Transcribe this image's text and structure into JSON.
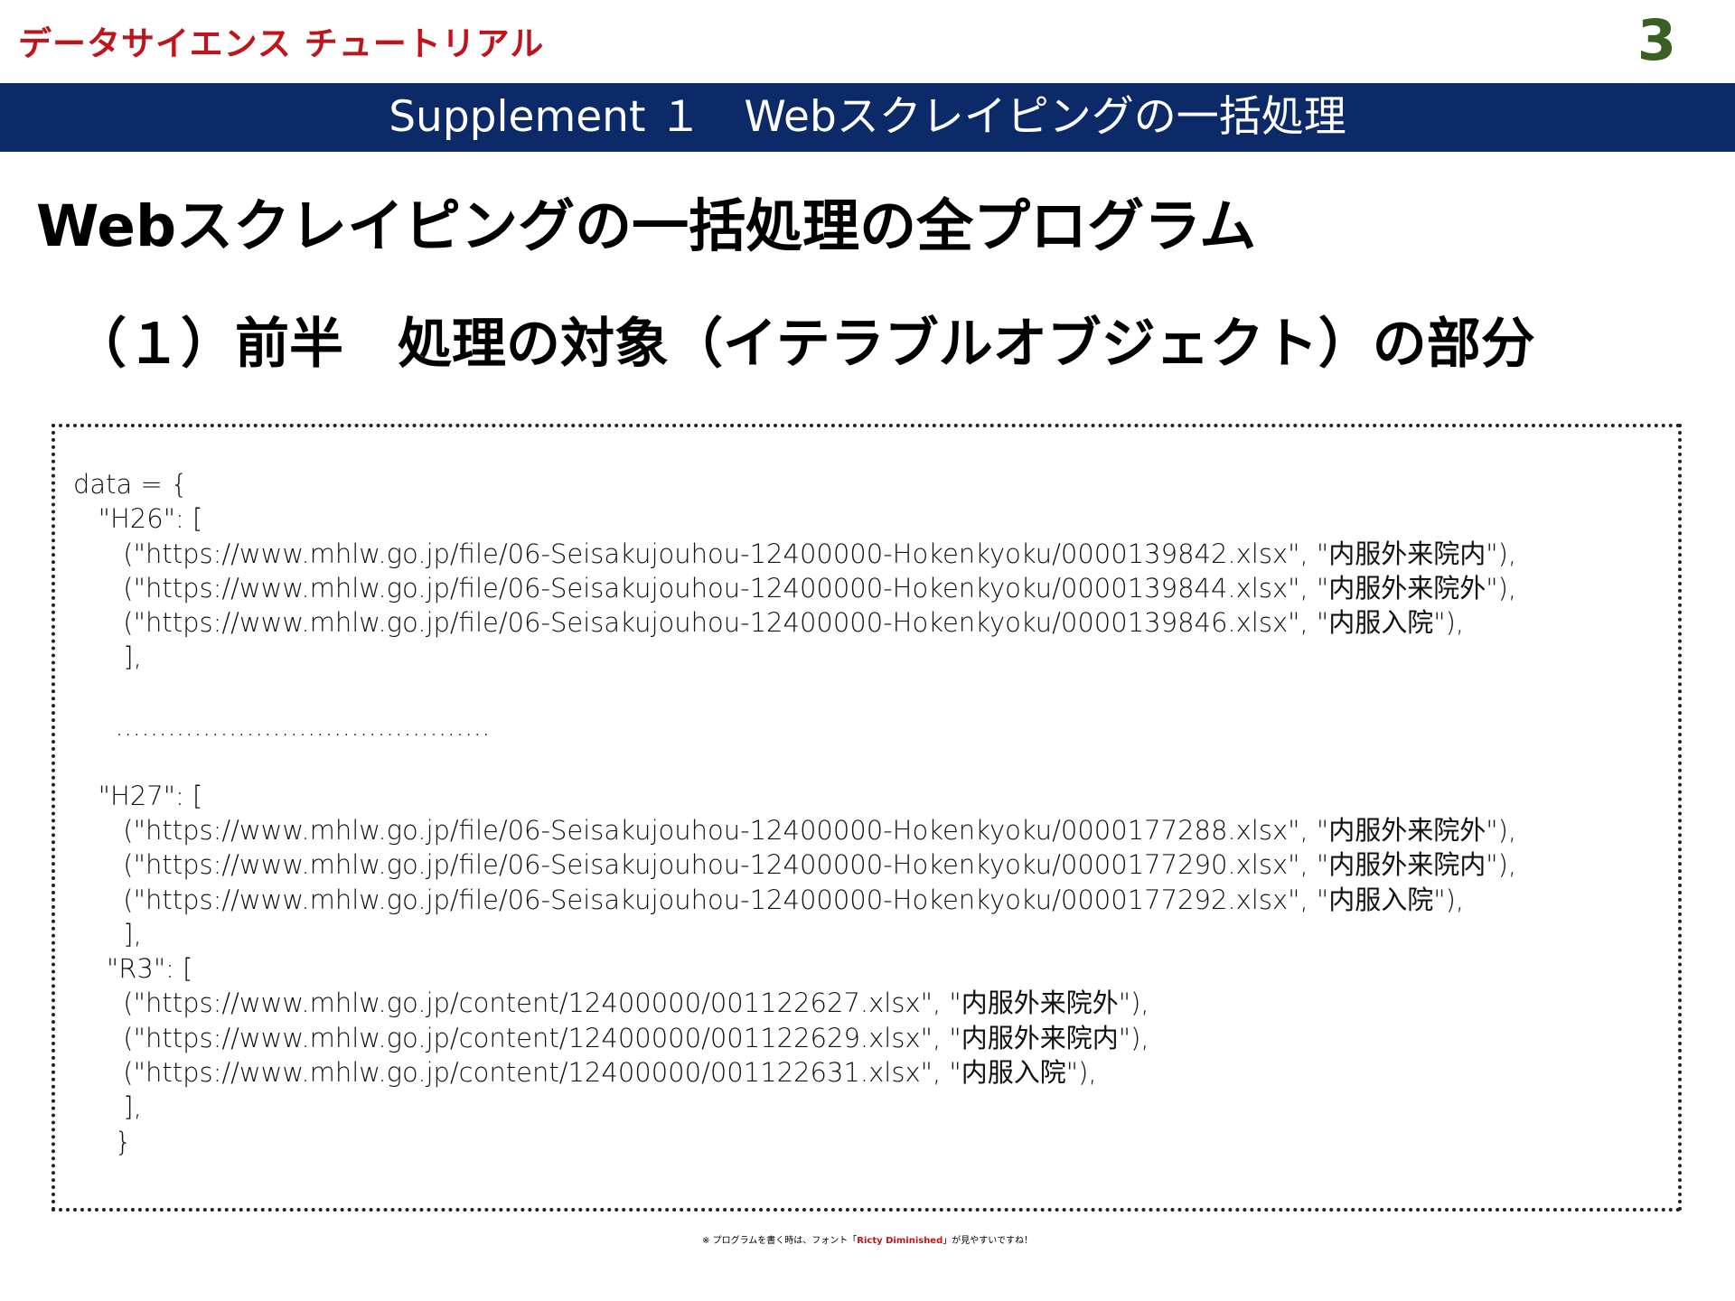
{
  "header": {
    "brand": "データサイエンス チュートリアル",
    "page_number": "3"
  },
  "banner": {
    "title": "Supplement １　Webスクレイピングの一括処理"
  },
  "main": {
    "heading": "Webスクレイピングの一括処理の全プログラム",
    "subheading": "（１）前半　処理の対象（イテラブルオブジェクト）の部分",
    "code_lines": [
      "data = {",
      "   \"H26\": [",
      "      (\"https://www.mhlw.go.jp/file/06-Seisakujouhou-12400000-Hokenkyoku/0000139842.xlsx\", \"内服外来院内\"),",
      "      (\"https://www.mhlw.go.jp/file/06-Seisakujouhou-12400000-Hokenkyoku/0000139844.xlsx\", \"内服外来院外\"),",
      "      (\"https://www.mhlw.go.jp/file/06-Seisakujouhou-12400000-Hokenkyoku/0000139846.xlsx\", \"内服入院\"),",
      "      ],",
      "",
      "     …………………………………….",
      "",
      "   \"H27\": [",
      "      (\"https://www.mhlw.go.jp/file/06-Seisakujouhou-12400000-Hokenkyoku/0000177288.xlsx\", \"内服外来院外\"),",
      "      (\"https://www.mhlw.go.jp/file/06-Seisakujouhou-12400000-Hokenkyoku/0000177290.xlsx\", \"内服外来院内\"),",
      "      (\"https://www.mhlw.go.jp/file/06-Seisakujouhou-12400000-Hokenkyoku/0000177292.xlsx\", \"内服入院\"),",
      "      ],",
      "    \"R3\": [",
      "      (\"https://www.mhlw.go.jp/content/12400000/001122627.xlsx\", \"内服外来院外\"),",
      "      (\"https://www.mhlw.go.jp/content/12400000/001122629.xlsx\", \"内服外来院内\"),",
      "      (\"https://www.mhlw.go.jp/content/12400000/001122631.xlsx\", \"内服入院\"),",
      "      ],",
      "     }"
    ]
  },
  "footer": {
    "note_prefix": "※ プログラムを書く時は、フォント「",
    "note_font": "Ricty Diminished",
    "note_suffix": "」が見やすいですね！"
  },
  "colors": {
    "brand_red": "#c0141c",
    "banner_navy": "#0c2968",
    "page_number_green": "#3a5f22"
  }
}
